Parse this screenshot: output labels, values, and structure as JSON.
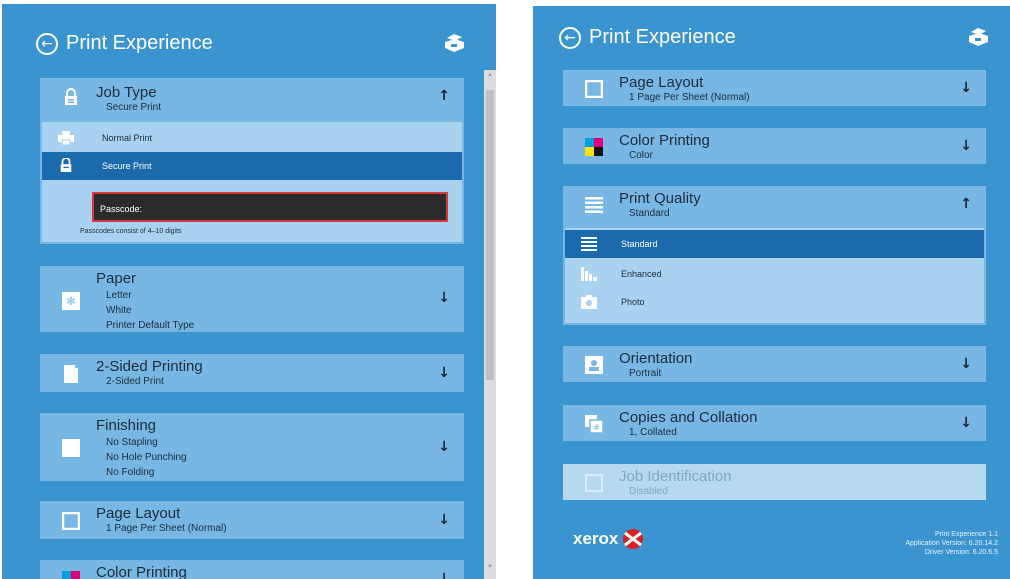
{
  "left": {
    "header": {
      "title": "Print Experience",
      "back_icon": "back-arrow-circle-icon",
      "printer_icon": "printer-icon"
    },
    "job_type": {
      "title": "Job Type",
      "value": "Secure Print",
      "options": [
        "Normal Print",
        "Secure Print"
      ],
      "selected": "Secure Print",
      "passcode_label": "Passcode:",
      "passcode_hint": "Passcodes consist of 4–10 digits"
    },
    "paper": {
      "title": "Paper",
      "values": [
        "Letter",
        "White",
        "Printer Default Type"
      ]
    },
    "two_sided": {
      "title": "2-Sided Printing",
      "value": "2-Sided Print"
    },
    "finishing": {
      "title": "Finishing",
      "values": [
        "No Stapling",
        "No Hole Punching",
        "No Folding"
      ]
    },
    "page_layout": {
      "title": "Page Layout",
      "value": "1 Page Per Sheet (Normal)"
    },
    "color_printing": {
      "title": "Color Printing"
    }
  },
  "right": {
    "header": {
      "title": "Print Experience"
    },
    "page_layout": {
      "title": "Page Layout",
      "value": "1 Page Per Sheet (Normal)"
    },
    "color_printing": {
      "title": "Color Printing",
      "value": "Color"
    },
    "print_quality": {
      "title": "Print Quality",
      "value": "Standard",
      "options": [
        "Standard",
        "Enhanced",
        "Photo"
      ],
      "selected": "Standard"
    },
    "orientation": {
      "title": "Orientation",
      "value": "Portrait"
    },
    "copies": {
      "title": "Copies and Collation",
      "value": "1, Collated"
    },
    "job_identification": {
      "title": "Job Identification",
      "value": "Disabled"
    },
    "footer": {
      "logo": "xerox",
      "app_name": "Print Experience 1.1",
      "app_version": "Application Version: 6.20.14.2",
      "driver_version": "Driver Version: 6.20.6.5"
    }
  },
  "colors": {
    "panel": "#3a94d0",
    "card": "#78b7e4",
    "selected": "#1b6aab",
    "options_bg": "#a8d2ef"
  }
}
